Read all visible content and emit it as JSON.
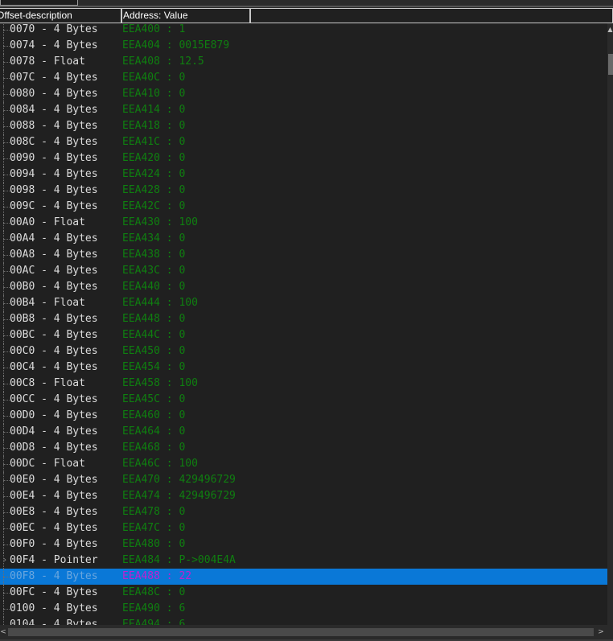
{
  "header": {
    "col_offset": "Offset-description",
    "col_address": "Address: Value",
    "col_extra": ""
  },
  "rows": [
    {
      "offset": "0070 - 4 Bytes",
      "addr": "EEA400 : 1"
    },
    {
      "offset": "0074 - 4 Bytes",
      "addr": "EEA404 : 0015E879"
    },
    {
      "offset": "0078 - Float  ",
      "addr": "EEA408 : 12.5"
    },
    {
      "offset": "007C - 4 Bytes",
      "addr": "EEA40C : 0"
    },
    {
      "offset": "0080 - 4 Bytes",
      "addr": "EEA410 : 0"
    },
    {
      "offset": "0084 - 4 Bytes",
      "addr": "EEA414 : 0"
    },
    {
      "offset": "0088 - 4 Bytes",
      "addr": "EEA418 : 0"
    },
    {
      "offset": "008C - 4 Bytes",
      "addr": "EEA41C : 0"
    },
    {
      "offset": "0090 - 4 Bytes",
      "addr": "EEA420 : 0"
    },
    {
      "offset": "0094 - 4 Bytes",
      "addr": "EEA424 : 0"
    },
    {
      "offset": "0098 - 4 Bytes",
      "addr": "EEA428 : 0"
    },
    {
      "offset": "009C - 4 Bytes",
      "addr": "EEA42C : 0"
    },
    {
      "offset": "00A0 - Float  ",
      "addr": "EEA430 : 100"
    },
    {
      "offset": "00A4 - 4 Bytes",
      "addr": "EEA434 : 0"
    },
    {
      "offset": "00A8 - 4 Bytes",
      "addr": "EEA438 : 0"
    },
    {
      "offset": "00AC - 4 Bytes",
      "addr": "EEA43C : 0"
    },
    {
      "offset": "00B0 - 4 Bytes",
      "addr": "EEA440 : 0"
    },
    {
      "offset": "00B4 - Float  ",
      "addr": "EEA444 : 100"
    },
    {
      "offset": "00B8 - 4 Bytes",
      "addr": "EEA448 : 0"
    },
    {
      "offset": "00BC - 4 Bytes",
      "addr": "EEA44C : 0"
    },
    {
      "offset": "00C0 - 4 Bytes",
      "addr": "EEA450 : 0"
    },
    {
      "offset": "00C4 - 4 Bytes",
      "addr": "EEA454 : 0"
    },
    {
      "offset": "00C8 - Float  ",
      "addr": "EEA458 : 100"
    },
    {
      "offset": "00CC - 4 Bytes",
      "addr": "EEA45C : 0"
    },
    {
      "offset": "00D0 - 4 Bytes",
      "addr": "EEA460 : 0"
    },
    {
      "offset": "00D4 - 4 Bytes",
      "addr": "EEA464 : 0"
    },
    {
      "offset": "00D8 - 4 Bytes",
      "addr": "EEA468 : 0"
    },
    {
      "offset": "00DC - Float  ",
      "addr": "EEA46C : 100"
    },
    {
      "offset": "00E0 - 4 Bytes",
      "addr": "EEA470 : 429496729"
    },
    {
      "offset": "00E4 - 4 Bytes",
      "addr": "EEA474 : 429496729"
    },
    {
      "offset": "00E8 - 4 Bytes",
      "addr": "EEA478 : 0"
    },
    {
      "offset": "00EC - 4 Bytes",
      "addr": "EEA47C : 0"
    },
    {
      "offset": "00F0 - 4 Bytes",
      "addr": "EEA480 : 0"
    },
    {
      "offset": "00F4 - Pointer",
      "addr": "EEA484 : P->004E4A",
      "expandable": true
    },
    {
      "offset": "00F8 - 4 Bytes",
      "addr": "EEA488 : 22",
      "selected": true
    },
    {
      "offset": "00FC - 4 Bytes",
      "addr": "EEA48C : 0"
    },
    {
      "offset": "0100 - 4 Bytes",
      "addr": "EEA490 : 6"
    },
    {
      "offset": "0104 - 4 Bytes",
      "addr": "EEA494 : 6"
    }
  ],
  "colors": {
    "background": "#202020",
    "offset_text": "#dcdcdc",
    "address_text": "#0f7f10",
    "selection": "#0a78d7",
    "selected_address_text": "#c020d0"
  },
  "icons": {
    "expander": "chevron-right-icon",
    "scroll_up": "arrow-up-icon",
    "scroll_left": "arrow-left-icon",
    "scroll_right": "arrow-right-icon"
  }
}
